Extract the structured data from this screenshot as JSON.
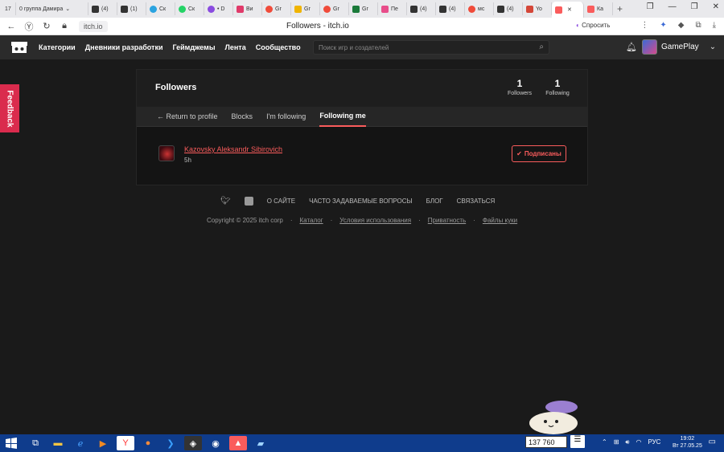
{
  "browser": {
    "tabs": [
      {
        "label": "17",
        "color": "#555"
      },
      {
        "label": "0  группа Дамира",
        "color": "#888"
      },
      {
        "label": "(4)",
        "color": "#333"
      },
      {
        "label": "(1)",
        "color": "#333"
      },
      {
        "label": "Ск",
        "color": "#2aa3e0"
      },
      {
        "label": "Ск",
        "color": "#25d366"
      },
      {
        "label": "• D",
        "color": "#8a4be0"
      },
      {
        "label": "Ви",
        "color": "#e03a6a"
      },
      {
        "label": "Gr",
        "color": "#f04b3a"
      },
      {
        "label": "Gr",
        "color": "#f0b400"
      },
      {
        "label": "Gr",
        "color": "#f04b3a"
      },
      {
        "label": "Gr",
        "color": "#1b7a3a"
      },
      {
        "label": "Пе",
        "color": "#e84d8a"
      },
      {
        "label": "(4)",
        "color": "#333"
      },
      {
        "label": "(4)",
        "color": "#333"
      },
      {
        "label": "мс",
        "color": "#f04b3a"
      },
      {
        "label": "(4)",
        "color": "#333"
      },
      {
        "label": "Yo",
        "color": "#d44638"
      },
      {
        "label": "",
        "color": "#fa5c5c"
      },
      {
        "label": "Ка",
        "color": "#fa5c5c"
      }
    ],
    "url": "itch.io",
    "page_title": "Followers - itch.io",
    "ask_label": "Спросить"
  },
  "site": {
    "nav": [
      "Категории",
      "Дневники разработки",
      "Геймджемы",
      "Лента",
      "Сообщество"
    ],
    "search_placeholder": "Поиск игр и создателей",
    "username": "GamePlay",
    "feedback": "Feedback"
  },
  "panel": {
    "title": "Followers",
    "followers_count": "1",
    "followers_label": "Followers",
    "following_count": "1",
    "following_label": "Following",
    "tabs": [
      {
        "label": "← Return to profile"
      },
      {
        "label": "Blocks"
      },
      {
        "label": "I'm following"
      },
      {
        "label": "Following me"
      }
    ],
    "row": {
      "name": "Kazovsky Aleksandr Sibirovich",
      "time": "5h",
      "button": "Подписаны"
    }
  },
  "footer": {
    "links": [
      "О САЙТЕ",
      "ЧАСТО ЗАДАВАЕМЫЕ ВОПРОСЫ",
      "БЛОГ",
      "СВЯЗАТЬСЯ"
    ],
    "copyright": "Copyright © 2025 itch corp",
    "legal": [
      "Каталог",
      "Условия использования",
      "Приватность",
      "Файлы куки"
    ]
  },
  "taskbar": {
    "counter": "137 760",
    "lang": "РУС",
    "time": "19:02",
    "date": "Вт 27.05.25"
  },
  "colors": {
    "accent": "#fa5c5c",
    "header": "#2b2b2b",
    "background": "#1a1a1a",
    "taskbar": "#0f3c8c",
    "feedback": "#da2b4d"
  }
}
